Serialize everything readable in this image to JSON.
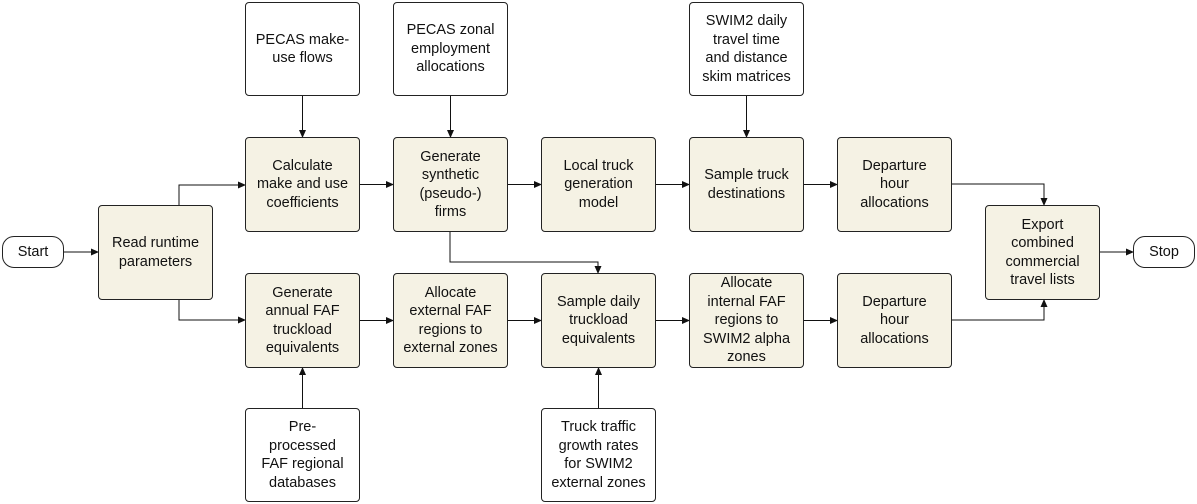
{
  "colors": {
    "process_fill": "#f5f2e4",
    "input_fill": "#ffffff",
    "stroke": "#222222"
  },
  "nodes": {
    "start": {
      "type": "terminal",
      "lines": [
        "Start"
      ]
    },
    "read_runtime": {
      "type": "process",
      "lines": [
        "Read runtime",
        "parameters"
      ]
    },
    "pecas_make_use": {
      "type": "input",
      "lines": [
        "PECAS make-",
        "use flows"
      ]
    },
    "pecas_zonal": {
      "type": "input",
      "lines": [
        "PECAS zonal",
        "employment",
        "allocations"
      ]
    },
    "swim2_skims": {
      "type": "input",
      "lines": [
        "SWIM2 daily",
        "travel time",
        "and distance",
        "skim matrices"
      ]
    },
    "calc_coefficients": {
      "type": "process",
      "lines": [
        "Calculate",
        "make and use",
        "coefficients"
      ]
    },
    "gen_firms": {
      "type": "process",
      "lines": [
        "Generate",
        "synthetic",
        "(pseudo-)",
        "firms"
      ]
    },
    "local_truck": {
      "type": "process",
      "lines": [
        "Local truck",
        "generation",
        "model"
      ]
    },
    "sample_destinations": {
      "type": "process",
      "lines": [
        "Sample truck",
        "destinations"
      ]
    },
    "departure_top": {
      "type": "process",
      "lines": [
        "Departure",
        "hour",
        "allocations"
      ]
    },
    "gen_faf": {
      "type": "process",
      "lines": [
        "Generate",
        "annual FAF",
        "truckload",
        "equivalents"
      ]
    },
    "allocate_external": {
      "type": "process",
      "lines": [
        "Allocate",
        "external FAF",
        "regions to",
        "external zones"
      ]
    },
    "sample_daily": {
      "type": "process",
      "lines": [
        "Sample daily",
        "truckload",
        "equivalents"
      ]
    },
    "allocate_internal": {
      "type": "process",
      "lines": [
        "Allocate",
        "internal FAF",
        "regions to",
        "SWIM2 alpha",
        "zones"
      ]
    },
    "departure_bottom": {
      "type": "process",
      "lines": [
        "Departure",
        "hour",
        "allocations"
      ]
    },
    "export": {
      "type": "process",
      "lines": [
        "Export",
        "combined",
        "commercial",
        "travel lists"
      ]
    },
    "stop": {
      "type": "terminal",
      "lines": [
        "Stop"
      ]
    },
    "preprocessed_faf": {
      "type": "input",
      "lines": [
        "Pre-",
        "processed",
        "FAF regional",
        "databases"
      ]
    },
    "truck_growth": {
      "type": "input",
      "lines": [
        "Truck traffic",
        "growth rates",
        "for SWIM2",
        "external zones"
      ]
    }
  },
  "edges": [
    [
      "start",
      "read_runtime"
    ],
    [
      "read_runtime",
      "calc_coefficients"
    ],
    [
      "read_runtime",
      "gen_faf"
    ],
    [
      "pecas_make_use",
      "calc_coefficients"
    ],
    [
      "pecas_zonal",
      "gen_firms"
    ],
    [
      "swim2_skims",
      "sample_destinations"
    ],
    [
      "calc_coefficients",
      "gen_firms"
    ],
    [
      "gen_firms",
      "local_truck"
    ],
    [
      "local_truck",
      "sample_destinations"
    ],
    [
      "sample_destinations",
      "departure_top"
    ],
    [
      "departure_top",
      "export"
    ],
    [
      "gen_faf",
      "allocate_external"
    ],
    [
      "allocate_external",
      "sample_daily"
    ],
    [
      "gen_firms",
      "sample_daily"
    ],
    [
      "sample_daily",
      "allocate_internal"
    ],
    [
      "allocate_internal",
      "departure_bottom"
    ],
    [
      "departure_bottom",
      "export"
    ],
    [
      "preprocessed_faf",
      "gen_faf"
    ],
    [
      "truck_growth",
      "sample_daily"
    ],
    [
      "export",
      "stop"
    ]
  ]
}
